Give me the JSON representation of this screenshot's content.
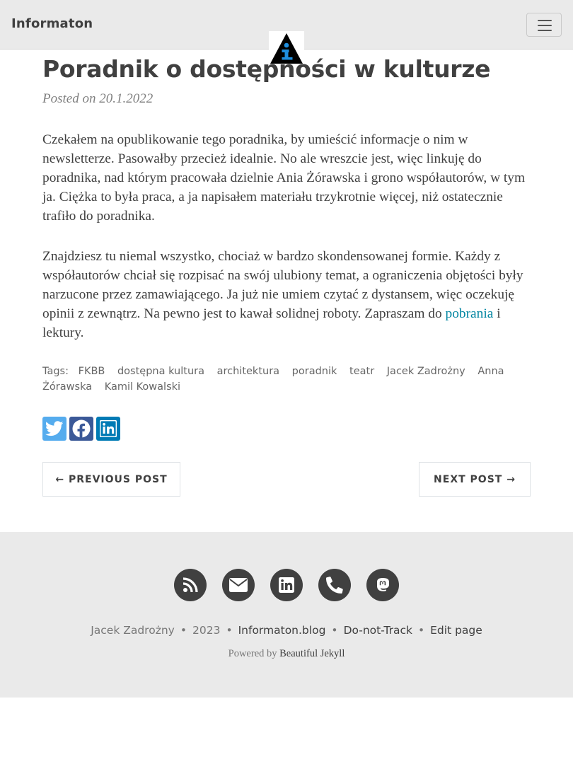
{
  "navbar": {
    "brand": "Informaton",
    "toggle_icon": "hamburger-icon",
    "logo_icon": "info-triangle-logo"
  },
  "post": {
    "title": "Poradnik o dostępności w kulturze",
    "meta": "Posted on 20.1.2022",
    "paragraph1": "Czekałem na opublikowanie tego poradnika, by umieścić informacje o nim w newsletterze. Pasowałby przecież idealnie. No ale wreszcie jest, więc linkuję do poradnika, nad którym pracowała dzielnie Ania Żórawska i grono współautorów, w tym ja. Ciężka to była praca, a ja napisałem materiału trzykrotnie więcej, niż ostatecznie trafiło do poradnika.",
    "paragraph2_text": "Znajdziesz tu niemal wszystko, chociaż w bardzo skondensowanej formie. Każdy z współautorów chciał się rozpisać na swój ulubiony temat, a ograniczenia objętości były narzucone przez zamawiającego. Ja już nie umiem czytać z dystansem, więc oczekuję opinii z zewnątrz. Na pewno jest to kawał solidnej roboty. Zapraszam do ",
    "paragraph2_link": "pobrania",
    "paragraph2_tail": " i lektury."
  },
  "tags": {
    "label": "Tags:",
    "items": [
      "FKBB",
      "dostępna kultura",
      "architektura",
      "poradnik",
      "teatr",
      "Jacek Zadrożny",
      "Anna Żórawska",
      "Kamil Kowalski"
    ]
  },
  "share": {
    "icons": [
      "twitter-icon",
      "facebook-icon",
      "linkedin-icon"
    ]
  },
  "pager": {
    "previous": "← PREVIOUS POST",
    "next": "NEXT POST →"
  },
  "footer": {
    "social_icons": [
      "rss-icon",
      "envelope-icon",
      "linkedin-icon",
      "phone-icon",
      "mastodon-icon"
    ],
    "author": "Jacek Zadrożny",
    "year": "2023",
    "site": "Informaton.blog",
    "dnt": "Do-not-Track",
    "edit": "Edit page",
    "powered_prefix": "Powered by ",
    "powered_link": "Beautiful Jekyll",
    "separator": "•"
  },
  "colors": {
    "navbar_bg": "#eaeaea",
    "link": "#0085a1",
    "footer_bg": "#eaeaea",
    "icon_circle": "#404040"
  }
}
